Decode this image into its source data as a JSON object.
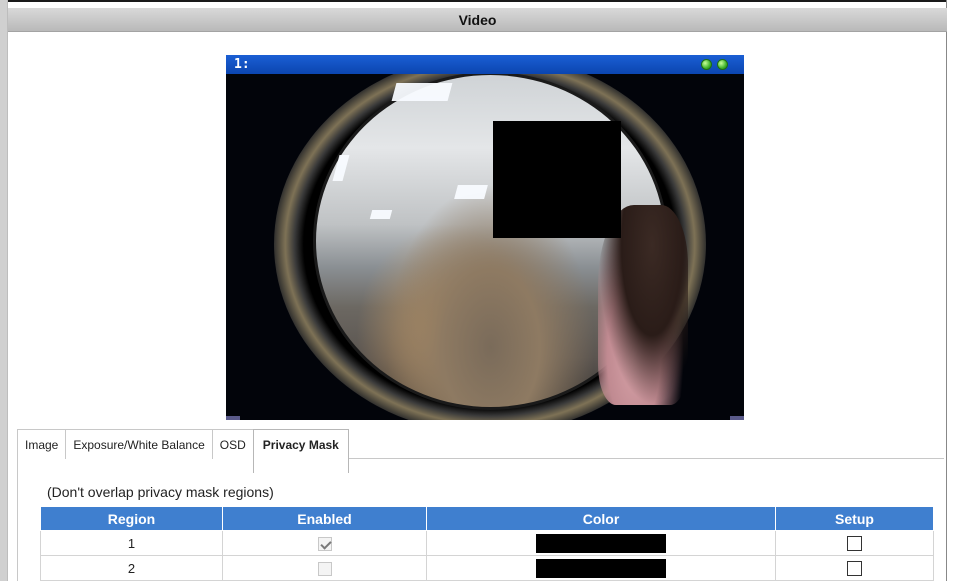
{
  "window": {
    "title": "Video"
  },
  "video": {
    "channel_label": "1:",
    "status_icons": [
      "green-status-icon",
      "green-status-icon"
    ]
  },
  "tabs": [
    {
      "label": "Image",
      "active": false
    },
    {
      "label": "Exposure/White Balance",
      "active": false
    },
    {
      "label": "OSD",
      "active": false
    },
    {
      "label": "Privacy Mask",
      "active": true
    }
  ],
  "privacy_mask": {
    "note": "(Don't overlap privacy mask regions)",
    "columns": [
      "Region",
      "Enabled",
      "Color",
      "Setup"
    ],
    "rows": [
      {
        "region": "1",
        "enabled": true,
        "color": "#000000",
        "setup": false
      },
      {
        "region": "2",
        "enabled": false,
        "color": "#000000",
        "setup": false
      }
    ]
  },
  "colors": {
    "header_blue": "#3f7fcf",
    "video_header": "#1b5fd4",
    "mask_color": "#000000"
  }
}
